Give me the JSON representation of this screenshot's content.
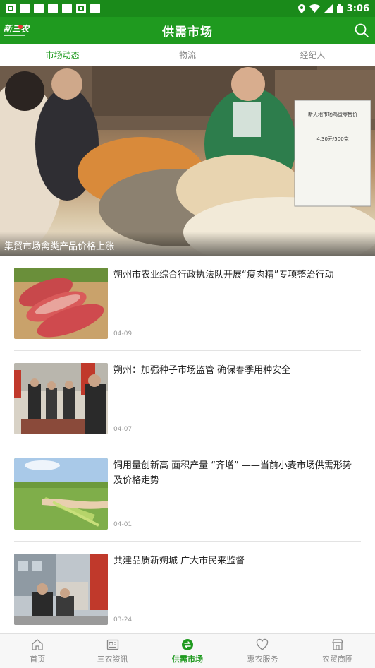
{
  "status_bar": {
    "time": "3:06"
  },
  "app_bar": {
    "title": "供需市场",
    "logo_text": "新三农"
  },
  "tabs": [
    {
      "label": "市场动态",
      "active": true
    },
    {
      "label": "物流",
      "active": false
    },
    {
      "label": "经纪人",
      "active": false
    }
  ],
  "banner": {
    "caption": "集贸市场禽类产品价格上涨",
    "sign_title": "新天地市场鸡蛋零售价",
    "sign_price": "4.30元/500克"
  },
  "news": [
    {
      "title": "朔州市农业综合行政执法队开展“瘦肉精”专项整治行动",
      "date": "04-09",
      "thumb": "pork-meat-photo"
    },
    {
      "title": "朔州：加强种子市场监管 确保春季用种安全",
      "date": "04-07",
      "thumb": "seed-inspection-photo"
    },
    {
      "title": "饲用量创新高 面积产量 “齐增” ——当前小麦市场供需形势及价格走势",
      "date": "04-01",
      "thumb": "wheat-field-photo"
    },
    {
      "title": "共建品质新朔城 广大市民来监督",
      "date": "03-24",
      "thumb": "street-inspection-photo"
    }
  ],
  "bottom_nav": [
    {
      "label": "首页",
      "icon": "home-icon",
      "active": false
    },
    {
      "label": "三农资讯",
      "icon": "news-icon",
      "active": false
    },
    {
      "label": "供需市场",
      "icon": "market-icon",
      "active": true
    },
    {
      "label": "惠农服务",
      "icon": "heart-icon",
      "active": false
    },
    {
      "label": "农贸商圈",
      "icon": "store-icon",
      "active": false
    }
  ],
  "colors": {
    "primary": "#1f9a1f",
    "statusbar": "#1a8a1a",
    "inactive": "#888888"
  }
}
